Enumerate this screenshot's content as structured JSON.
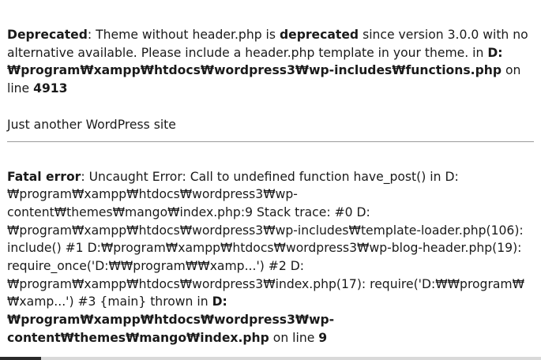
{
  "deprecated_notice": {
    "label": "Deprecated",
    "text1": ": Theme without header.php is ",
    "emphasis": "deprecated",
    "text2": " since version 3.0.0 with no alternative available. Please include a header.php template in your theme. in ",
    "file": "D:₩program₩xampp₩htdocs₩wordpress3₩wp-includes₩functions.php",
    "on_line": " on line ",
    "line": "4913"
  },
  "site": {
    "description": "Just another WordPress site"
  },
  "fatal_error": {
    "label": "Fatal error",
    "message": ": Uncaught Error: Call to undefined function have_post() in D:₩program₩xampp₩htdocs₩wordpress3₩wp-content₩themes₩mango₩index.php:9 Stack trace: #0 D:₩program₩xampp₩htdocs₩wordpress3₩wp-includes₩template-loader.php(106): include() #1 D:₩program₩xampp₩htdocs₩wordpress3₩wp-blog-header.php(19): require_once('D:₩₩program₩₩xamp...') #2 D:₩program₩xampp₩htdocs₩wordpress3₩index.php(17): require('D:₩₩program₩₩xamp...') #3 {main} thrown in ",
    "file": "D:₩program₩xampp₩htdocs₩wordpress3₩wp-content₩themes₩mango₩index.php",
    "on_line": " on line ",
    "line": "9"
  },
  "colors": {
    "text": "#1a1a1a",
    "separator": "#9a9a9a",
    "scrollbar_thumb": "#2b2b2b"
  }
}
